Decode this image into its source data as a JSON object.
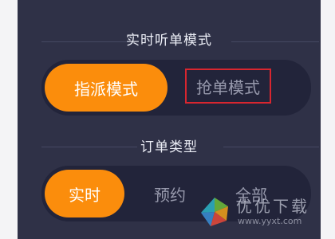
{
  "order_mode": {
    "title": "实时听单模式",
    "options": [
      {
        "label": "指派模式",
        "selected": true
      },
      {
        "label": "抢单模式",
        "selected": false
      }
    ]
  },
  "order_type": {
    "title": "订单类型",
    "options": [
      {
        "label": "实时",
        "selected": true
      },
      {
        "label": "预约",
        "selected": false
      },
      {
        "label": "全部",
        "selected": false
      }
    ]
  },
  "watermark": {
    "text": "优优下载",
    "url": "www.yyxt.com"
  },
  "colors": {
    "panel_background": "#2f3147",
    "segment_track": "#22243a",
    "accent_orange": "#fb8d0c",
    "inactive_text": "#9799ac",
    "highlight_box": "#d8262f"
  }
}
